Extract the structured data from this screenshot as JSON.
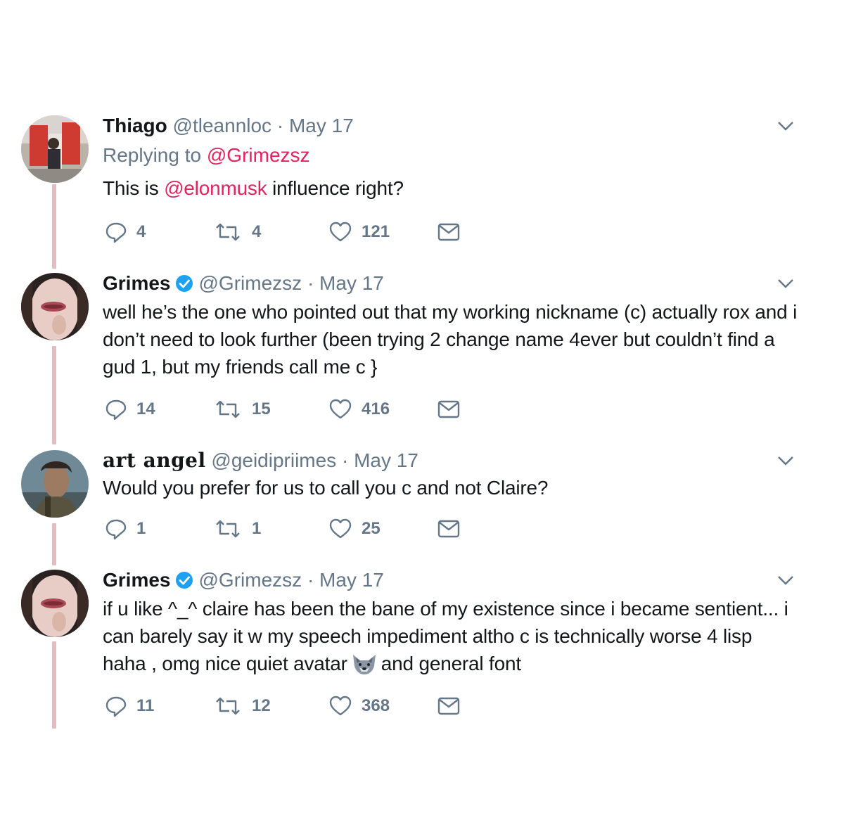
{
  "tweets": [
    {
      "name": "Thiago",
      "handle": "@tleannloc",
      "date": "· May 17",
      "replying_label": "Replying to",
      "replying_handle": "@Grimezsz",
      "text_before": "This is ",
      "mention": "@elonmusk",
      "text_after": " influence right?",
      "replies": "4",
      "retweets": "4",
      "likes": "121"
    },
    {
      "name": "Grimes",
      "verified": true,
      "handle": "@Grimezsz",
      "date": "· May 17",
      "text": "well he’s the one who pointed out that my working nickname (c) actually rox and i don’t need to look further (been trying 2 change name 4ever but couldn’t find a gud 1, but my friends call me c }",
      "replies": "14",
      "retweets": "15",
      "likes": "416"
    },
    {
      "name": "art angel",
      "handle": "@geidipriimes",
      "date": "· May 17",
      "text": "Would you prefer for us to call you c and not Claire?",
      "replies": "1",
      "retweets": "1",
      "likes": "25"
    },
    {
      "name": "Grimes",
      "verified": true,
      "handle": "@Grimezsz",
      "date": "· May 17",
      "text_line1": "if u like ^_^ claire has been the bane of my existence since i became sentient... i",
      "text_line2": "can barely say it w my speech impediment altho c is technically worse 4 lisp",
      "text_line3a": "haha , omg nice quiet avatar",
      "emoji": "wolf-emoji",
      "text_line3b": "and general font",
      "replies": "11",
      "retweets": "12",
      "likes": "368"
    }
  ],
  "colors": {
    "accent": "#e0245e",
    "muted": "#657786",
    "text": "#14171a",
    "verified": "#1da1f2",
    "thread_line": "#e1bcc3"
  },
  "icons": [
    "reply-icon",
    "retweet-icon",
    "like-icon",
    "message-icon",
    "caret-down-icon",
    "verified-badge-icon"
  ]
}
